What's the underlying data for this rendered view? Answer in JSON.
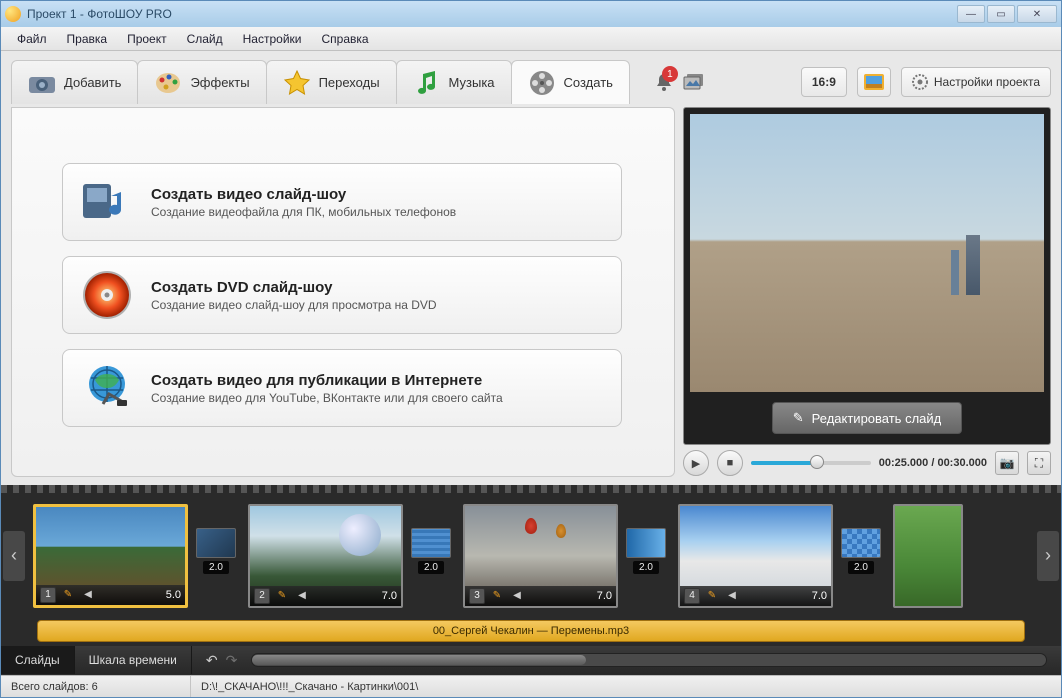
{
  "window": {
    "title": "Проект 1 - ФотоШОУ PRO"
  },
  "menubar": [
    "Файл",
    "Правка",
    "Проект",
    "Слайд",
    "Настройки",
    "Справка"
  ],
  "tabs": [
    {
      "label": "Добавить",
      "icon": "camera"
    },
    {
      "label": "Эффекты",
      "icon": "palette"
    },
    {
      "label": "Переходы",
      "icon": "star"
    },
    {
      "label": "Музыка",
      "icon": "music"
    },
    {
      "label": "Создать",
      "icon": "reel",
      "active": true
    }
  ],
  "toolbar": {
    "notification_count": "1",
    "aspect_label": "16:9",
    "project_settings_label": "Настройки проекта"
  },
  "create_options": [
    {
      "title": "Создать видео слайд-шоу",
      "subtitle": "Создание видеофайла для ПК, мобильных телефонов",
      "icon": "video-device"
    },
    {
      "title": "Создать DVD слайд-шоу",
      "subtitle": "Создание видео слайд-шоу для просмотра на DVD",
      "icon": "dvd"
    },
    {
      "title": "Создать видео для публикации в Интернете",
      "subtitle": "Создание видео для YouTube, ВКонтакте или для своего сайта",
      "icon": "globe"
    }
  ],
  "preview": {
    "edit_button": "Редактировать слайд",
    "time": "00:25.000 / 00:30.000"
  },
  "timeline": {
    "slides": [
      {
        "num": "1",
        "dur": "5.0",
        "trans_dur": "2.0",
        "img": "mountains1"
      },
      {
        "num": "2",
        "dur": "7.0",
        "trans_dur": "2.0",
        "img": "planet"
      },
      {
        "num": "3",
        "dur": "7.0",
        "trans_dur": "2.0",
        "img": "balloons"
      },
      {
        "num": "4",
        "dur": "7.0",
        "trans_dur": "2.0",
        "img": "snow"
      }
    ],
    "audio_track": "00_Сергей Чекалин — Перемены.mp3",
    "mode_tabs": [
      "Слайды",
      "Шкала времени"
    ]
  },
  "statusbar": {
    "slide_count_label": "Всего слайдов: 6",
    "path": "D:\\!_СКАЧАНО\\!!!_Скачано - Картинки\\001\\"
  }
}
